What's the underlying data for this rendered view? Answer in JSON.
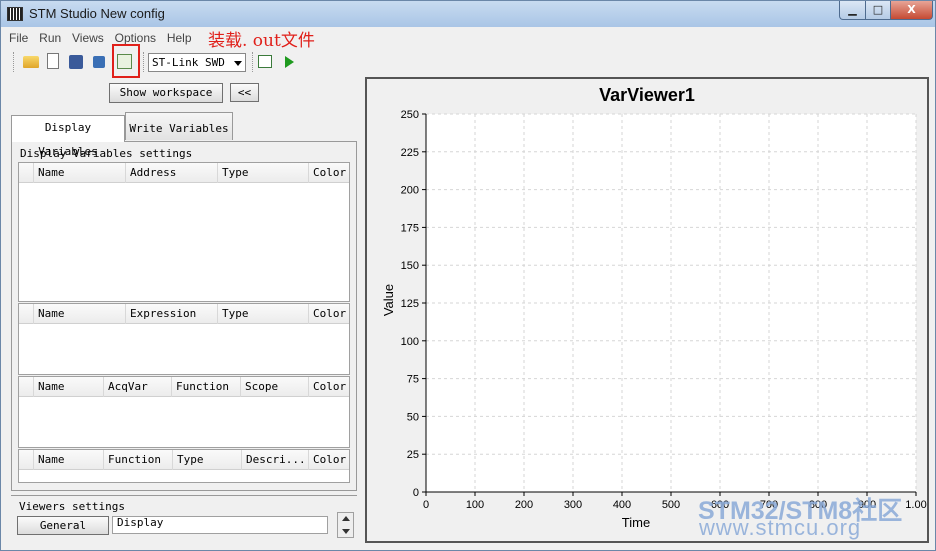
{
  "window": {
    "title": "STM Studio New config",
    "controls": {
      "minimize": "▁",
      "maximize": "□",
      "close": "X"
    }
  },
  "menu": {
    "items": [
      "File",
      "Run",
      "Views",
      "Options",
      "Help"
    ]
  },
  "annotation": {
    "text": "装载. out文件",
    "color": "#e0201a"
  },
  "toolbar": {
    "icons": [
      "open-folder-icon",
      "new-file-icon",
      "save-as-icon",
      "save-icon",
      "load-out-file-icon",
      "config-icon",
      "run-icon"
    ],
    "probe": "ST-Link SWD"
  },
  "left": {
    "show_workspace": "Show workspace",
    "collapse": "<<",
    "tabs": [
      "Display Variables",
      "Write Variables"
    ],
    "settings_title": "Display Variables settings",
    "table1_headers": [
      "Name",
      "Address",
      "Type",
      "Color"
    ],
    "table2_headers": [
      "Name",
      "Expression",
      "Type",
      "Color"
    ],
    "table3_headers": [
      "Name",
      "AcqVar",
      "Function",
      "Scope",
      "Color"
    ],
    "table4_headers": [
      "Name",
      "Function",
      "Type",
      "Descri...",
      "Color"
    ],
    "viewers_title": "Viewers settings",
    "general": "General",
    "display": "Display"
  },
  "chart_data": {
    "type": "line",
    "title": "VarViewer1",
    "xlabel": "Time",
    "ylabel": "Value",
    "xlim": [
      0,
      1000
    ],
    "ylim": [
      0,
      250
    ],
    "xticks": [
      "0",
      "100",
      "200",
      "300",
      "400",
      "500",
      "600",
      "700",
      "800",
      "900",
      "1.00"
    ],
    "yticks": [
      "0",
      "25",
      "50",
      "75",
      "100",
      "125",
      "150",
      "175",
      "200",
      "225",
      "250"
    ],
    "grid": true,
    "series": []
  },
  "watermark": {
    "line1": "STM32/STM8社区",
    "line2": "www.stmcu.org"
  }
}
